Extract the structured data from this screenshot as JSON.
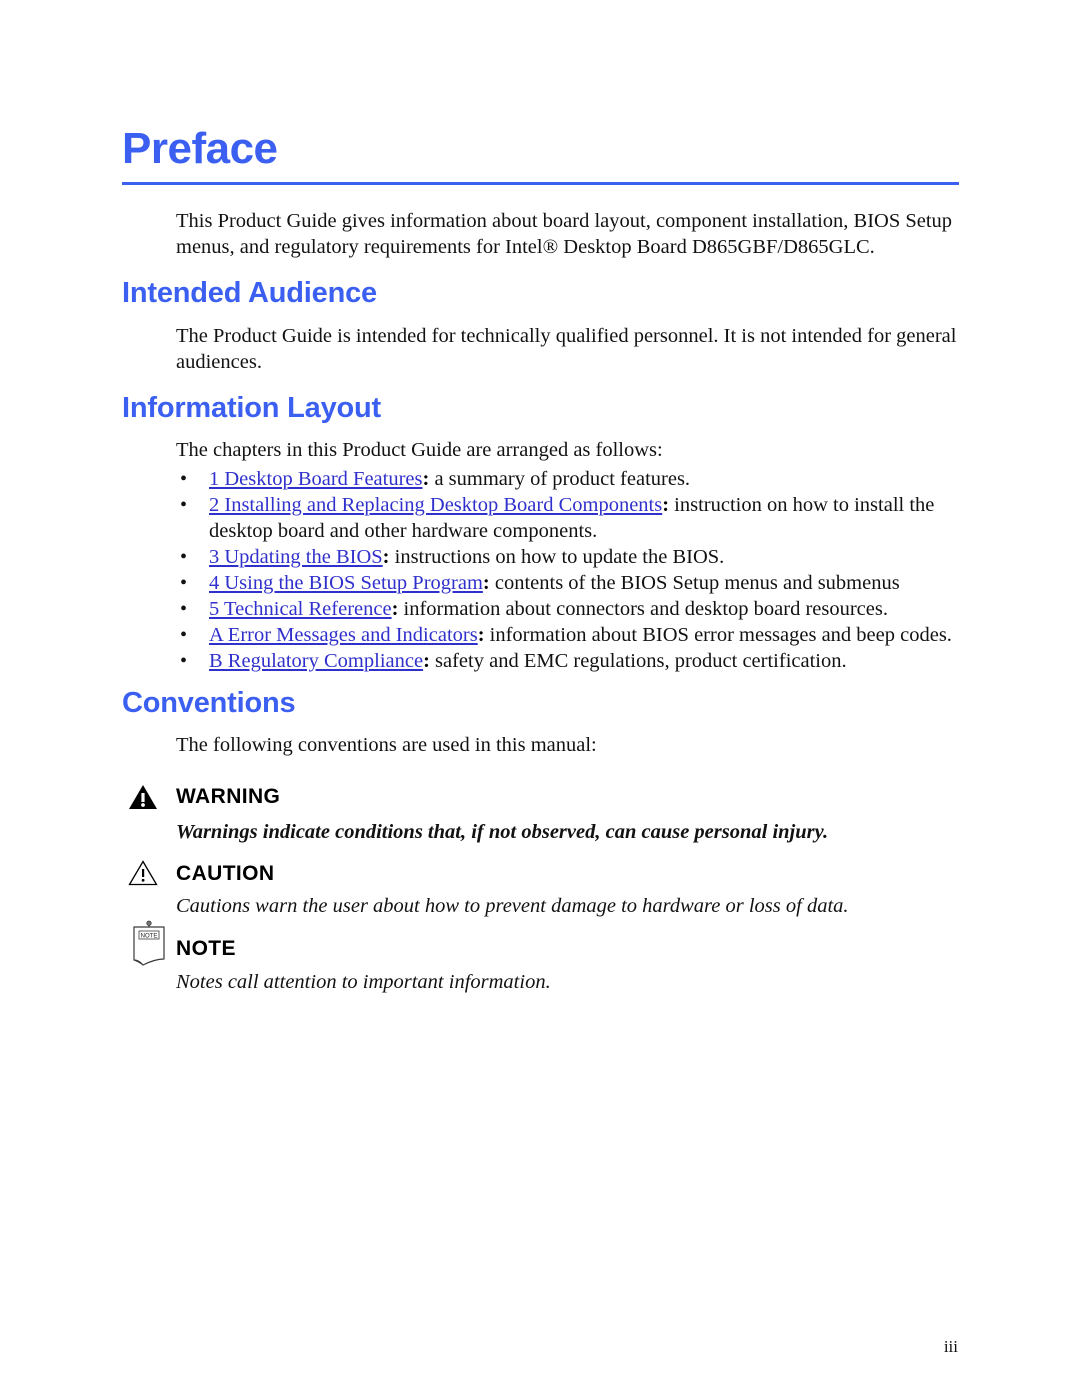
{
  "document": {
    "page_title": "Preface",
    "folio": "iii",
    "accent_color": "#3b5ff0",
    "link_color": "#3030cc"
  },
  "intro": {
    "paragraph": "This Product Guide gives information about board layout, component installation, BIOS Setup menus, and regulatory requirements for Intel® Desktop Board D865GBF/D865GLC."
  },
  "sections": {
    "intended_audience": {
      "heading": "Intended Audience",
      "paragraph": "The Product Guide is intended for technically qualified personnel.  It is not intended for general audiences."
    },
    "information_layout": {
      "heading": "Information Layout",
      "paragraph": "The chapters in this Product Guide are arranged as follows:",
      "bullets": [
        {
          "link": "1 Desktop Board Features",
          "colon": ":",
          "text": " a summary of product features."
        },
        {
          "link": "2 Installing and Replacing Desktop Board Components",
          "colon": ":",
          "text": " instruction on how to install the desktop board and other hardware components."
        },
        {
          "link": "3 Updating the BIOS",
          "colon": ":",
          "text": " instructions on how to update the BIOS."
        },
        {
          "link": "4 Using the BIOS Setup Program",
          "colon": ":",
          "text": " contents of the BIOS Setup menus and submenus"
        },
        {
          "link": "5 Technical Reference",
          "colon": ":",
          "text": " information about connectors and desktop board resources."
        },
        {
          "link": "A Error Messages and Indicators",
          "colon": ":",
          "text": " information about BIOS error messages and beep codes."
        },
        {
          "link": "B Regulatory Compliance",
          "colon": ":",
          "text": " safety and EMC regulations, product certification."
        }
      ]
    },
    "conventions": {
      "heading": "Conventions",
      "paragraph": "The following conventions are used in this manual:",
      "admonitions": [
        {
          "icon": "warning-triangle-filled-icon",
          "label": "WARNING",
          "text": "Warnings indicate conditions that, if not observed, can cause personal injury."
        },
        {
          "icon": "caution-triangle-outline-icon",
          "label": "CAUTION",
          "text": "Cautions warn the user about how to prevent damage to hardware or loss of data."
        },
        {
          "icon": "note-page-icon",
          "icon_label": "NOTE",
          "label": "NOTE",
          "text": "Notes call attention to important information."
        }
      ]
    }
  }
}
